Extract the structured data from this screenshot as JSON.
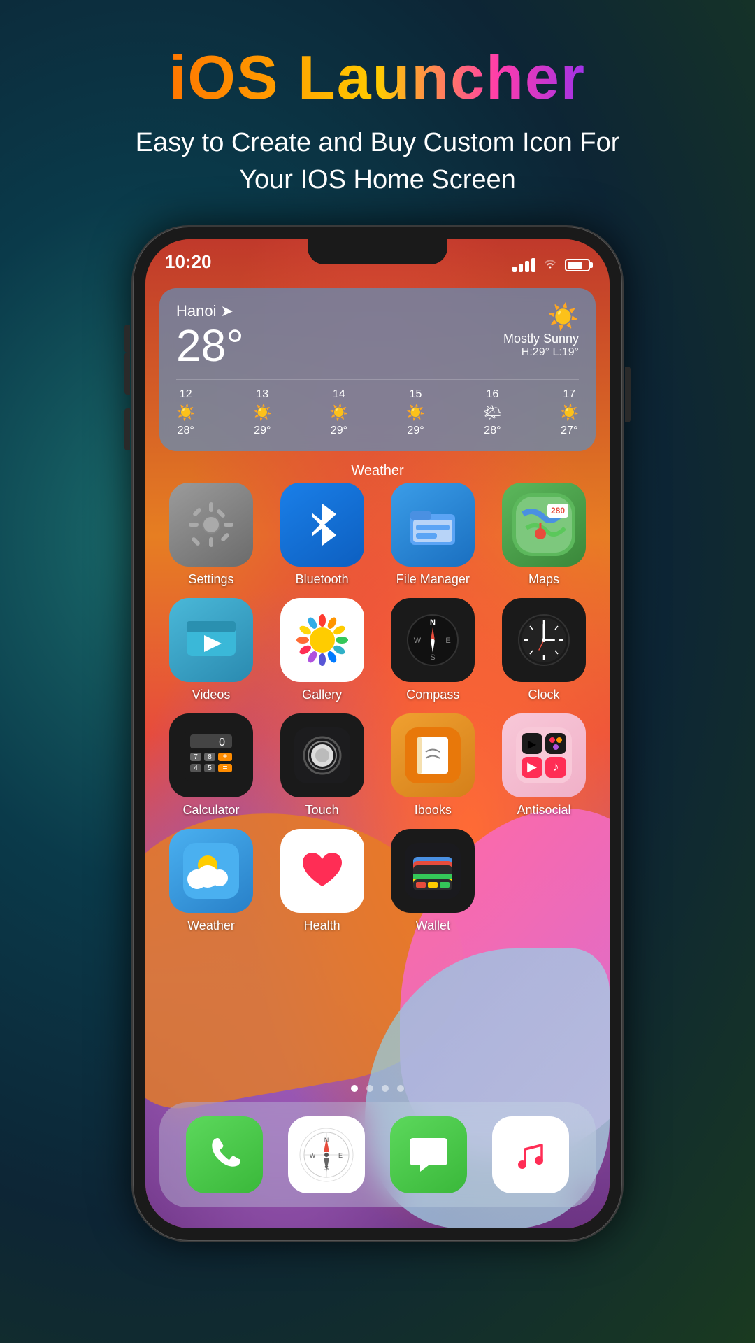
{
  "header": {
    "title": "iOS Launcher",
    "subtitle": "Easy to Create and Buy Custom Icon For\nYour IOS Home Screen"
  },
  "status_bar": {
    "time": "10:20"
  },
  "weather_widget": {
    "location": "Hanoi",
    "temperature": "28°",
    "condition": "Mostly Sunny",
    "high": "H:29°",
    "low": "L:19°",
    "forecast": [
      {
        "date": "12",
        "icon": "☀️",
        "temp": "28°"
      },
      {
        "date": "13",
        "icon": "☀️",
        "temp": "29°"
      },
      {
        "date": "14",
        "icon": "☀️",
        "temp": "29°"
      },
      {
        "date": "15",
        "icon": "☀️",
        "temp": "29°"
      },
      {
        "date": "16",
        "icon": "🌤",
        "temp": "28°"
      },
      {
        "date": "17",
        "icon": "☀️",
        "temp": "27°"
      }
    ]
  },
  "section_label": "Weather",
  "apps": [
    [
      {
        "id": "settings",
        "label": "Settings",
        "icon_type": "settings"
      },
      {
        "id": "bluetooth",
        "label": "Bluetooth",
        "icon_type": "bluetooth"
      },
      {
        "id": "file-manager",
        "label": "File Manager",
        "icon_type": "files"
      },
      {
        "id": "maps",
        "label": "Maps",
        "icon_type": "maps"
      }
    ],
    [
      {
        "id": "videos",
        "label": "Videos",
        "icon_type": "videos"
      },
      {
        "id": "gallery",
        "label": "Gallery",
        "icon_type": "gallery"
      },
      {
        "id": "compass",
        "label": "Compass",
        "icon_type": "compass"
      },
      {
        "id": "clock",
        "label": "Clock",
        "icon_type": "clock"
      }
    ],
    [
      {
        "id": "calculator",
        "label": "Calculator",
        "icon_type": "calculator"
      },
      {
        "id": "touch",
        "label": "Touch",
        "icon_type": "touch"
      },
      {
        "id": "ibooks",
        "label": "Ibooks",
        "icon_type": "ibooks"
      },
      {
        "id": "antisocial",
        "label": "Antisocial",
        "icon_type": "antisocial"
      }
    ],
    [
      {
        "id": "weather",
        "label": "Weather",
        "icon_type": "weather"
      },
      {
        "id": "health",
        "label": "Health",
        "icon_type": "health"
      },
      {
        "id": "wallet",
        "label": "Wallet",
        "icon_type": "wallet"
      },
      {
        "id": "empty",
        "label": "",
        "icon_type": "empty"
      }
    ]
  ],
  "dock": [
    {
      "id": "phone",
      "label": "Phone",
      "icon_type": "dock-phone"
    },
    {
      "id": "safari",
      "label": "Safari",
      "icon_type": "dock-safari"
    },
    {
      "id": "messages",
      "label": "Messages",
      "icon_type": "dock-messages"
    },
    {
      "id": "music",
      "label": "Music",
      "icon_type": "dock-music"
    }
  ],
  "page_dots": [
    {
      "active": true
    },
    {
      "active": false
    },
    {
      "active": false
    },
    {
      "active": false
    }
  ]
}
